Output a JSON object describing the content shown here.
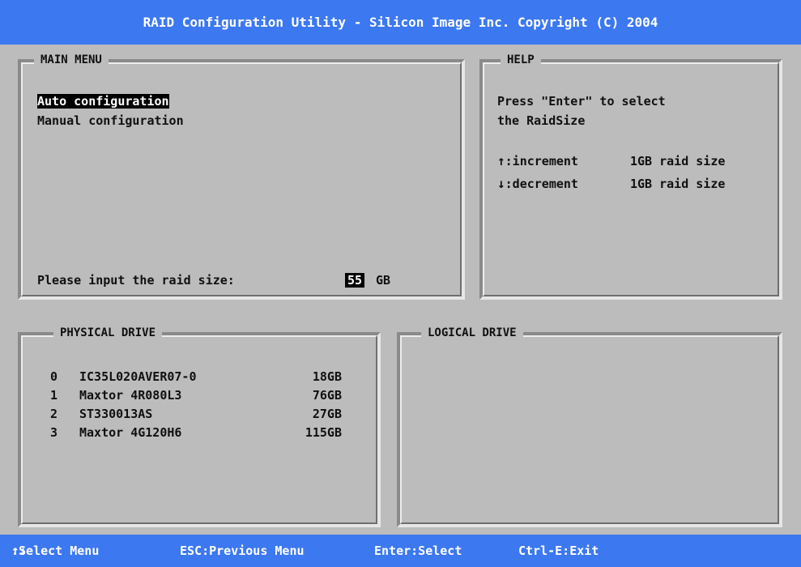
{
  "title": "RAID Configuration Utility - Silicon Image Inc. Copyright (C) 2004",
  "main_menu": {
    "title": "MAIN MENU",
    "items": [
      {
        "label": "Auto configuration",
        "selected": true
      },
      {
        "label": "Manual configuration",
        "selected": false
      }
    ],
    "prompt_label": "Please input the raid size:",
    "raid_size_value": "55",
    "raid_size_unit": "GB"
  },
  "help": {
    "title": "HELP",
    "line1": "Press \"Enter\" to select",
    "line2": "the RaidSize",
    "up_arrow": "↑",
    "down_arrow": "↓",
    "increment_text": ":increment",
    "decrement_text": ":decrement",
    "increment_amount": "1GB raid size",
    "decrement_amount": "1GB raid size"
  },
  "physical_drive": {
    "title": "PHYSICAL DRIVE",
    "drives": [
      {
        "index": "0",
        "model": "IC35L020AVER07-0",
        "size": "18GB"
      },
      {
        "index": "1",
        "model": "Maxtor 4R080L3",
        "size": "76GB"
      },
      {
        "index": "2",
        "model": "ST330013AS",
        "size": "27GB"
      },
      {
        "index": "3",
        "model": "Maxtor 4G120H6",
        "size": "115GB"
      }
    ]
  },
  "logical_drive": {
    "title": "LOGICAL DRIVE"
  },
  "statusbar": {
    "select_arrows": "↑↓",
    "select_text": ":Select Menu",
    "esc": "ESC:Previous Menu",
    "enter": "Enter:Select",
    "ctrl_e": "Ctrl-E:Exit"
  },
  "colors": {
    "bar_blue": "#3c78f0",
    "background": "#bcbcbc"
  }
}
